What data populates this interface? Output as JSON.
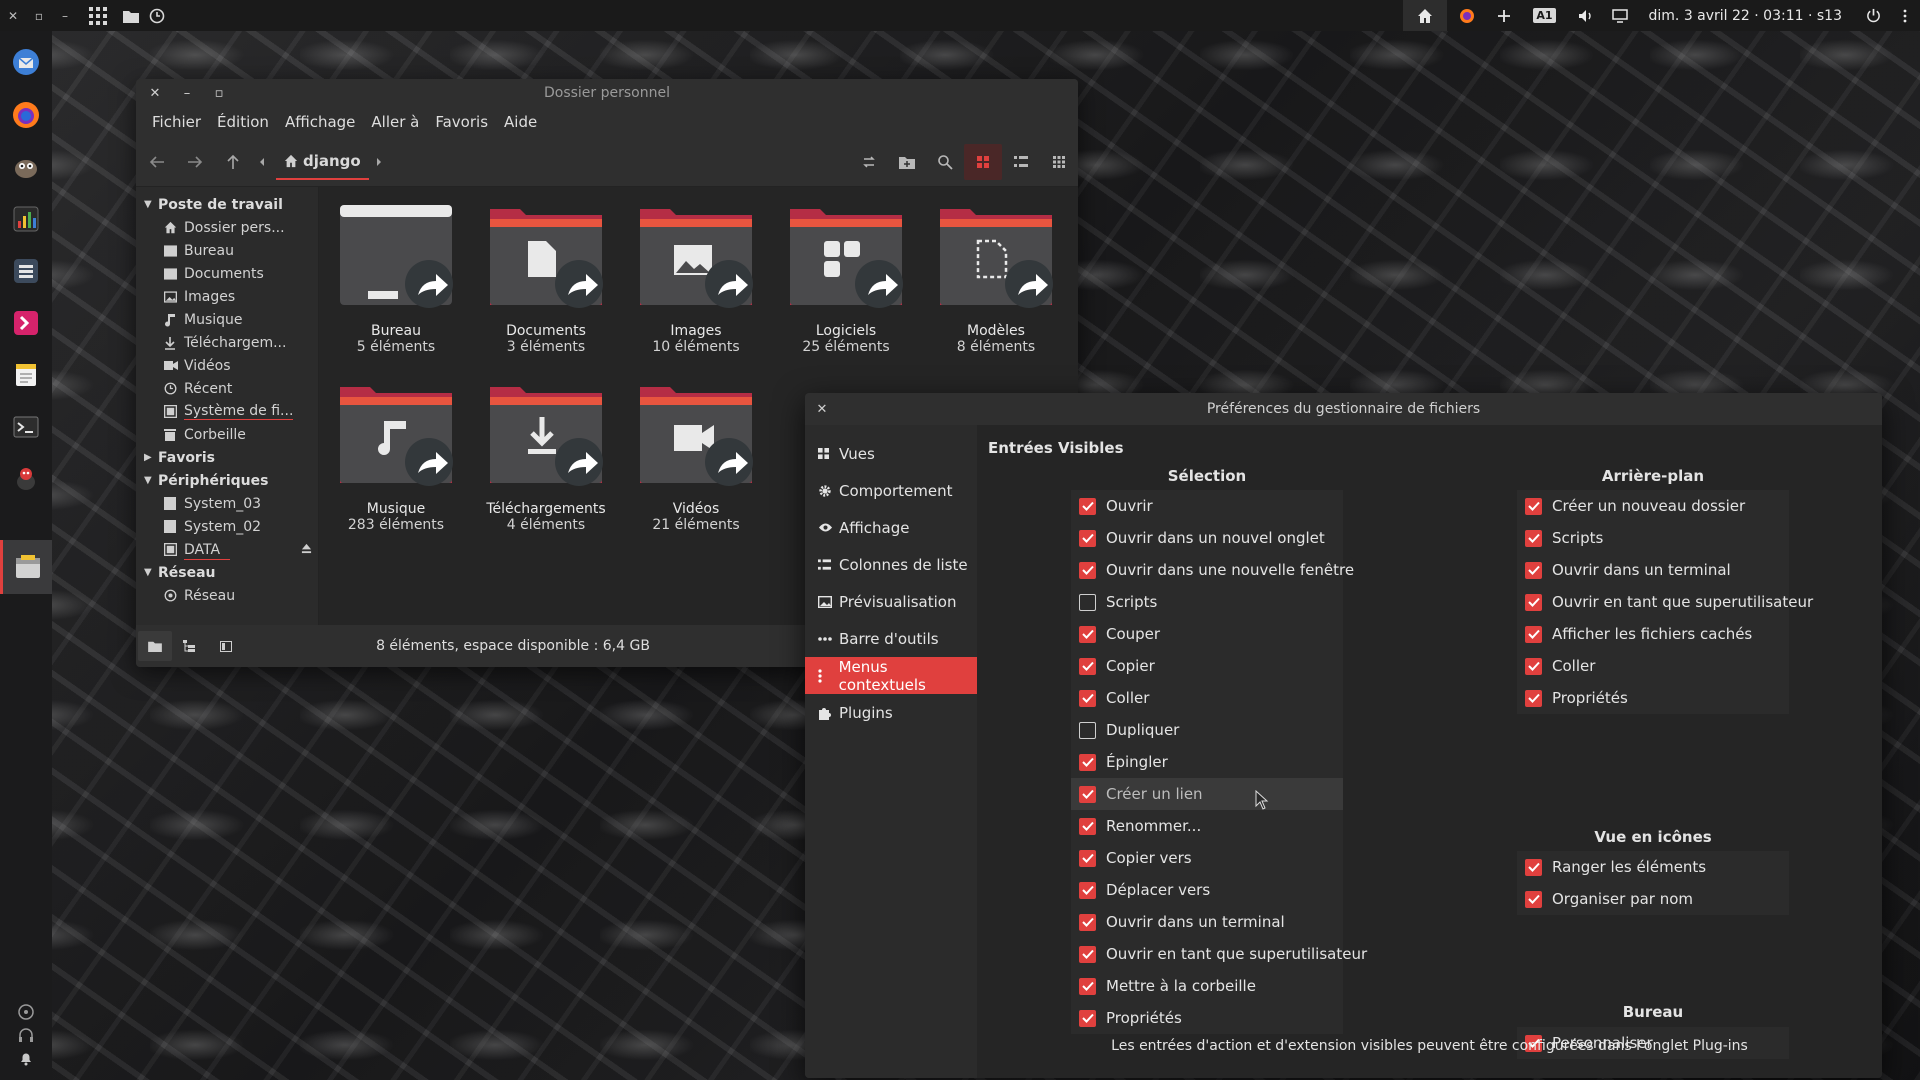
{
  "top_panel": {
    "clock": "dim. 3 avril 22 · 03:11 · s13",
    "keyboard_indicator": "A1"
  },
  "dock": {
    "apps": [
      "thunderbird-icon",
      "firefox-icon",
      "gimp-icon",
      "monitor-icon",
      "tasks-icon",
      "anydesk-icon",
      "editor-icon",
      "terminal-icon",
      "game-icon",
      "file-manager-icon"
    ]
  },
  "file_manager": {
    "title": "Dossier personnel",
    "menu": [
      "Fichier",
      "Édition",
      "Affichage",
      "Aller à",
      "Favoris",
      "Aide"
    ],
    "location": "django",
    "sidebar": {
      "sections": {
        "workstation": "Poste de travail",
        "favorites": "Favoris",
        "devices": "Périphériques",
        "network": "Réseau"
      },
      "workstation_items": [
        "Dossier pers...",
        "Bureau",
        "Documents",
        "Images",
        "Musique",
        "Téléchargem...",
        "Vidéos",
        "Récent",
        "Système de fi...",
        "Corbeille"
      ],
      "device_items": [
        "System_03",
        "System_02",
        "DATA"
      ],
      "network_items": [
        "Réseau"
      ]
    },
    "folders": [
      {
        "name": "Bureau",
        "count": "5 éléments"
      },
      {
        "name": "Documents",
        "count": "3 éléments"
      },
      {
        "name": "Images",
        "count": "10 éléments"
      },
      {
        "name": "Logiciels",
        "count": "25 éléments"
      },
      {
        "name": "Modèles",
        "count": "8 éléments"
      },
      {
        "name": "Musique",
        "count": "283 éléments"
      },
      {
        "name": "Téléchargements",
        "count": "4 éléments"
      },
      {
        "name": "Vidéos",
        "count": "21 éléments"
      }
    ],
    "status": "8 éléments, espace disponible : 6,4 GB"
  },
  "preferences": {
    "title": "Préférences du gestionnaire de fichiers",
    "nav": [
      "Vues",
      "Comportement",
      "Affichage",
      "Colonnes de liste",
      "Prévisualisation",
      "Barre d'outils",
      "Menus contextuels",
      "Plugins"
    ],
    "active_nav": "Menus contextuels",
    "heading": "Entrées Visibles",
    "groups": {
      "selection": {
        "title": "Sélection",
        "items": [
          {
            "label": "Ouvrir",
            "checked": true
          },
          {
            "label": "Ouvrir dans un nouvel onglet",
            "checked": true
          },
          {
            "label": "Ouvrir dans une nouvelle fenêtre",
            "checked": true
          },
          {
            "label": "Scripts",
            "checked": false
          },
          {
            "label": "Couper",
            "checked": true
          },
          {
            "label": "Copier",
            "checked": true
          },
          {
            "label": "Coller",
            "checked": true
          },
          {
            "label": "Dupliquer",
            "checked": false
          },
          {
            "label": "Épingler",
            "checked": true
          },
          {
            "label": "Créer un lien",
            "checked": true
          },
          {
            "label": "Renommer...",
            "checked": true
          },
          {
            "label": "Copier vers",
            "checked": true
          },
          {
            "label": "Déplacer vers",
            "checked": true
          },
          {
            "label": "Ouvrir dans un terminal",
            "checked": true
          },
          {
            "label": "Ouvrir en tant que superutilisateur",
            "checked": true
          },
          {
            "label": "Mettre à la corbeille",
            "checked": true
          },
          {
            "label": "Propriétés",
            "checked": true
          }
        ]
      },
      "background": {
        "title": "Arrière-plan",
        "items": [
          {
            "label": "Créer un nouveau dossier",
            "checked": true
          },
          {
            "label": "Scripts",
            "checked": true
          },
          {
            "label": "Ouvrir dans un terminal",
            "checked": true
          },
          {
            "label": "Ouvrir en tant que superutilisateur",
            "checked": true
          },
          {
            "label": "Afficher les fichiers cachés",
            "checked": true
          },
          {
            "label": "Coller",
            "checked": true
          },
          {
            "label": "Propriétés",
            "checked": true
          }
        ]
      },
      "icon_view": {
        "title": "Vue en icônes",
        "items": [
          {
            "label": "Ranger les éléments",
            "checked": true
          },
          {
            "label": "Organiser par nom",
            "checked": true
          }
        ]
      },
      "desktop": {
        "title": "Bureau",
        "items": [
          {
            "label": "Personnaliser",
            "checked": true
          }
        ]
      }
    },
    "footer": "Les entrées d'action et d'extension visibles peuvent être configurées dans l'onglet Plug-ins"
  },
  "colors": {
    "accent": "#e0403e",
    "folder_tab": "#b52d45",
    "folder_body": "#4a4a4c"
  }
}
